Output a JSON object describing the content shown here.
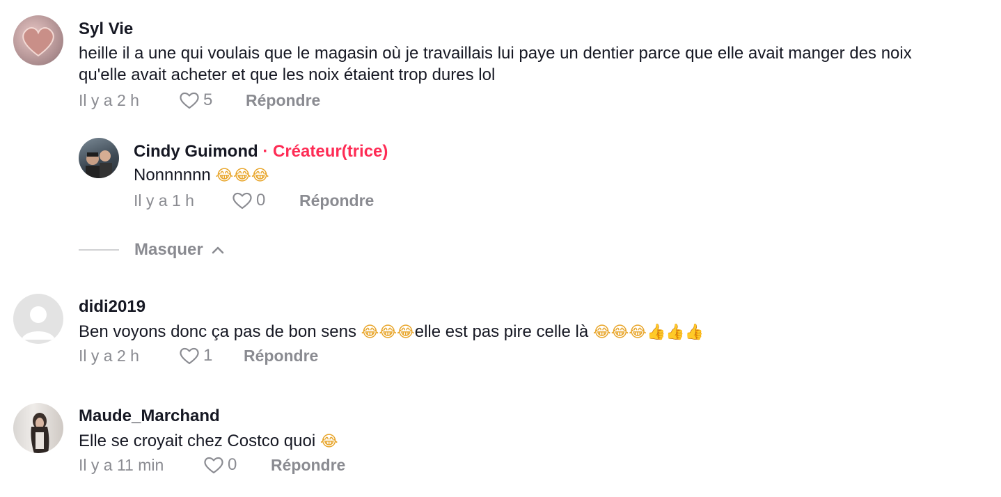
{
  "comments": [
    {
      "username": "Syl Vie",
      "text_line1": "heille il a une qui voulais que le magasin où je travaillais lui paye un dentier parce que elle avait manger des noix",
      "text_line2": "qu'elle avait acheter et que les noix étaient trop dures lol",
      "time": "Il y a 2 h",
      "likes": "5",
      "reply_label": "Répondre",
      "avatar_icon": "pink-heart-avatar",
      "replies": [
        {
          "username": "Cindy Guimond",
          "creator_badge": "· Créateur(trice)",
          "text": "Nonnnnnn",
          "emoji": "😂😂😂",
          "time": "Il y a 1 h",
          "likes": "0",
          "reply_label": "Répondre"
        }
      ],
      "hide_label": "Masquer"
    },
    {
      "username": "didi2019",
      "text_a": "Ben voyons donc ça pas de bon sens ",
      "emoji_a": "😂😂😂",
      "text_b": "elle est pas pire celle là ",
      "emoji_b": "😂😂😂👍👍👍",
      "time": "Il y a 2 h",
      "likes": "1",
      "reply_label": "Répondre",
      "avatar_icon": "default-user-avatar"
    },
    {
      "username": "Maude_Marchand",
      "text": "Elle se croyait chez Costco quoi ",
      "emoji": "😂",
      "time": "Il y a 11 min",
      "likes": "0",
      "reply_label": "Répondre"
    }
  ],
  "colors": {
    "creator": "#fe2c55",
    "meta": "#8a8b91",
    "text": "#161823"
  }
}
